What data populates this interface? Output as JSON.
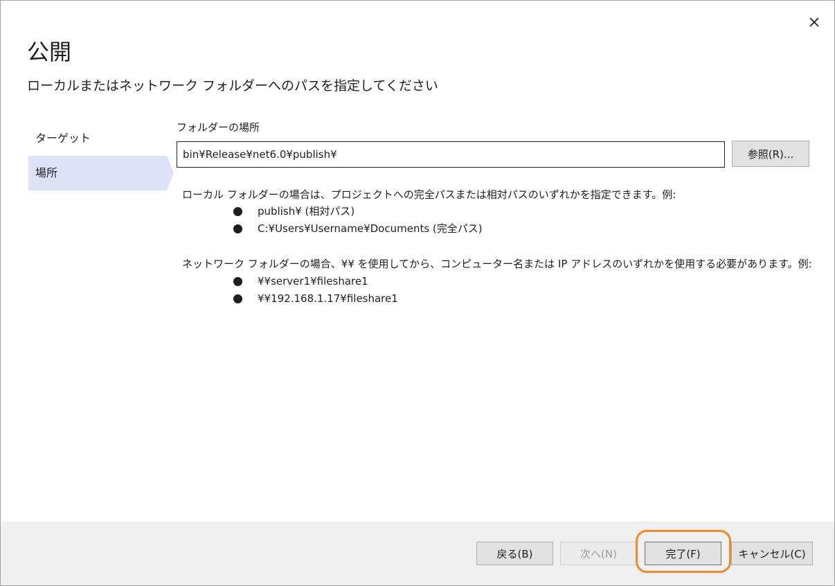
{
  "dialog": {
    "title": "公開",
    "subtitle": "ローカルまたはネットワーク フォルダーへのパスを指定してください"
  },
  "icons": {
    "close": "close-icon"
  },
  "nav": {
    "items": [
      {
        "label": "ターゲット",
        "active": false
      },
      {
        "label": "場所",
        "active": true
      }
    ]
  },
  "folder": {
    "label": "フォルダーの場所",
    "value": "bin¥Release¥net6.0¥publish¥",
    "browse_label": "参照(R)..."
  },
  "help": {
    "local_text": "ローカル フォルダーの場合は、プロジェクトへの完全パスまたは相対パスのいずれかを指定できます。例:",
    "local_examples": [
      "publish¥ (相対パス)",
      "C:¥Users¥Username¥Documents (完全パス)"
    ],
    "network_text": "ネットワーク フォルダーの場合、¥¥ を使用してから、コンピューター名または IP アドレスのいずれかを使用する必要があります。例:",
    "network_examples": [
      "¥¥server1¥fileshare1",
      "¥¥192.168.1.17¥fileshare1"
    ]
  },
  "footer": {
    "back_label": "戻る(B)",
    "next_label": "次へ(N)",
    "finish_label": "完了(F)",
    "cancel_label": "キャンセル(C)"
  },
  "colors": {
    "nav_active_bg": "#dee2f8",
    "highlight": "#f08a2c",
    "footer_bg": "#f0f0f0"
  }
}
